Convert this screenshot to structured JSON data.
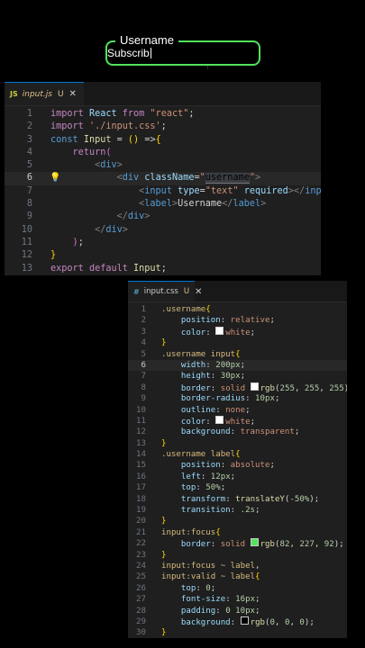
{
  "demo": {
    "label": "Username",
    "value": "Subscrib",
    "accent": "#52e35c"
  },
  "jsx_editor": {
    "tab": {
      "icon_text": "JS",
      "filename": "input.js",
      "status": "U",
      "close": "✕",
      "icon_color": "#cbcb41"
    },
    "lines": [
      [
        [
          "k",
          "import "
        ],
        [
          "v",
          "React "
        ],
        [
          "k",
          "from "
        ],
        [
          "s",
          "\"react\""
        ],
        [
          "p",
          ";"
        ]
      ],
      [
        [
          "k",
          "import "
        ],
        [
          "s",
          "'./input.css'"
        ],
        [
          "p",
          ";"
        ]
      ],
      [
        [
          "kb",
          "const "
        ],
        [
          "f",
          "Input "
        ],
        [
          "p",
          "= "
        ],
        [
          "br1",
          "()"
        ],
        [
          "p",
          " =>"
        ],
        [
          "br1",
          "{"
        ]
      ],
      [
        [
          "p",
          "    "
        ],
        [
          "k",
          "return"
        ],
        [
          "br2",
          "("
        ]
      ],
      [
        [
          "p",
          "        "
        ],
        [
          "tg",
          "<"
        ],
        [
          "kb",
          "div"
        ],
        [
          "tg",
          ">"
        ]
      ],
      [
        [
          "p",
          "            "
        ],
        [
          "tg",
          "<"
        ],
        [
          "kb",
          "div "
        ],
        [
          "at",
          "className"
        ],
        [
          "p",
          "="
        ],
        [
          "s",
          "\""
        ],
        [
          "hl",
          "username"
        ],
        [
          "s",
          "\""
        ],
        [
          "tg",
          ">"
        ]
      ],
      [
        [
          "p",
          "                "
        ],
        [
          "tg",
          "<"
        ],
        [
          "kb",
          "input "
        ],
        [
          "at",
          "type"
        ],
        [
          "p",
          "="
        ],
        [
          "s",
          "\"text\" "
        ],
        [
          "at",
          "required"
        ],
        [
          "tg",
          "></"
        ],
        [
          "kb",
          "input"
        ],
        [
          "tg",
          ">"
        ]
      ],
      [
        [
          "p",
          "                "
        ],
        [
          "tg",
          "<"
        ],
        [
          "kb",
          "label"
        ],
        [
          "tg",
          ">"
        ],
        [
          "tx",
          "Username"
        ],
        [
          "tg",
          "</"
        ],
        [
          "kb",
          "label"
        ],
        [
          "tg",
          ">"
        ]
      ],
      [
        [
          "p",
          "            "
        ],
        [
          "tg",
          "</"
        ],
        [
          "kb",
          "div"
        ],
        [
          "tg",
          ">"
        ]
      ],
      [
        [
          "p",
          "        "
        ],
        [
          "tg",
          "</"
        ],
        [
          "kb",
          "div"
        ],
        [
          "tg",
          ">"
        ]
      ],
      [
        [
          "p",
          "    "
        ],
        [
          "br2",
          ")"
        ],
        [
          "p",
          ";"
        ]
      ],
      [
        [
          "br1",
          "}"
        ]
      ],
      [
        [
          "k",
          "export "
        ],
        [
          "k",
          "default "
        ],
        [
          "f",
          "Input"
        ],
        [
          "p",
          ";"
        ]
      ]
    ]
  },
  "css_editor": {
    "tab": {
      "icon_text": "#",
      "filename": "input.css",
      "status": "U",
      "close": "✕",
      "icon_color": "#519aba"
    },
    "lines": [
      [
        [
          "sel",
          ".username"
        ],
        [
          "br1",
          "{"
        ]
      ],
      [
        [
          "p",
          "    "
        ],
        [
          "prop",
          "position"
        ],
        [
          "p",
          ": "
        ],
        [
          "val",
          "relative"
        ],
        [
          "p",
          ";"
        ]
      ],
      [
        [
          "p",
          "    "
        ],
        [
          "prop",
          "color"
        ],
        [
          "p",
          ": "
        ],
        [
          "sw",
          "#ffffff"
        ],
        [
          "val",
          "white"
        ],
        [
          "p",
          ";"
        ]
      ],
      [
        [
          "br1",
          "}"
        ]
      ],
      [
        [
          "sel",
          ".username input"
        ],
        [
          "br1",
          "{"
        ]
      ],
      [
        [
          "p",
          "    "
        ],
        [
          "prop",
          "width"
        ],
        [
          "p",
          ": "
        ],
        [
          "num",
          "200px"
        ],
        [
          "p",
          ";"
        ]
      ],
      [
        [
          "p",
          "    "
        ],
        [
          "prop",
          "height"
        ],
        [
          "p",
          ": "
        ],
        [
          "num",
          "30px"
        ],
        [
          "p",
          ";"
        ]
      ],
      [
        [
          "p",
          "    "
        ],
        [
          "prop",
          "border"
        ],
        [
          "p",
          ": "
        ],
        [
          "val",
          "solid "
        ],
        [
          "sw",
          "#ffffff"
        ],
        [
          "f",
          "rgb"
        ],
        [
          "p",
          "("
        ],
        [
          "num",
          "255"
        ],
        [
          "p",
          ", "
        ],
        [
          "num",
          "255"
        ],
        [
          "p",
          ", "
        ],
        [
          "num",
          "255"
        ],
        [
          "p",
          ");"
        ]
      ],
      [
        [
          "p",
          "    "
        ],
        [
          "prop",
          "border-radius"
        ],
        [
          "p",
          ": "
        ],
        [
          "num",
          "10px"
        ],
        [
          "p",
          ";"
        ]
      ],
      [
        [
          "p",
          "    "
        ],
        [
          "prop",
          "outline"
        ],
        [
          "p",
          ": "
        ],
        [
          "val",
          "none"
        ],
        [
          "p",
          ";"
        ]
      ],
      [
        [
          "p",
          "    "
        ],
        [
          "prop",
          "color"
        ],
        [
          "p",
          ": "
        ],
        [
          "sw",
          "#ffffff"
        ],
        [
          "val",
          "white"
        ],
        [
          "p",
          ";"
        ]
      ],
      [
        [
          "p",
          "    "
        ],
        [
          "prop",
          "background"
        ],
        [
          "p",
          ": "
        ],
        [
          "val",
          "transparent"
        ],
        [
          "p",
          ";"
        ]
      ],
      [
        [
          "br1",
          "}"
        ]
      ],
      [
        [
          "sel",
          ".username label"
        ],
        [
          "br1",
          "{"
        ]
      ],
      [
        [
          "p",
          "    "
        ],
        [
          "prop",
          "position"
        ],
        [
          "p",
          ": "
        ],
        [
          "val",
          "absolute"
        ],
        [
          "p",
          ";"
        ]
      ],
      [
        [
          "p",
          "    "
        ],
        [
          "prop",
          "left"
        ],
        [
          "p",
          ": "
        ],
        [
          "num",
          "12px"
        ],
        [
          "p",
          ";"
        ]
      ],
      [
        [
          "p",
          "    "
        ],
        [
          "prop",
          "top"
        ],
        [
          "p",
          ": "
        ],
        [
          "num",
          "50%"
        ],
        [
          "p",
          ";"
        ]
      ],
      [
        [
          "p",
          "    "
        ],
        [
          "prop",
          "transform"
        ],
        [
          "p",
          ": "
        ],
        [
          "f",
          "translateY"
        ],
        [
          "p",
          "("
        ],
        [
          "num",
          "-50%"
        ],
        [
          "p",
          ");"
        ]
      ],
      [
        [
          "p",
          "    "
        ],
        [
          "prop",
          "transition"
        ],
        [
          "p",
          ": "
        ],
        [
          "num",
          ".2s"
        ],
        [
          "p",
          ";"
        ]
      ],
      [
        [
          "br1",
          "}"
        ]
      ],
      [
        [
          "sel",
          "input:focus"
        ],
        [
          "br1",
          "{"
        ]
      ],
      [
        [
          "p",
          "    "
        ],
        [
          "prop",
          "border"
        ],
        [
          "p",
          ": "
        ],
        [
          "val",
          "solid "
        ],
        [
          "sw",
          "#52e35c"
        ],
        [
          "f",
          "rgb"
        ],
        [
          "p",
          "("
        ],
        [
          "num",
          "82"
        ],
        [
          "p",
          ", "
        ],
        [
          "num",
          "227"
        ],
        [
          "p",
          ", "
        ],
        [
          "num",
          "92"
        ],
        [
          "p",
          ");"
        ]
      ],
      [
        [
          "br1",
          "}"
        ]
      ],
      [
        [
          "sel",
          "input:focus ~ label"
        ],
        [
          "p",
          ","
        ]
      ],
      [
        [
          "sel",
          "input:valid ~ label"
        ],
        [
          "br1",
          "{"
        ]
      ],
      [
        [
          "p",
          "    "
        ],
        [
          "prop",
          "top"
        ],
        [
          "p",
          ": "
        ],
        [
          "num",
          "0"
        ],
        [
          "p",
          ";"
        ]
      ],
      [
        [
          "p",
          "    "
        ],
        [
          "prop",
          "font-size"
        ],
        [
          "p",
          ": "
        ],
        [
          "num",
          "16px"
        ],
        [
          "p",
          ";"
        ]
      ],
      [
        [
          "p",
          "    "
        ],
        [
          "prop",
          "padding"
        ],
        [
          "p",
          ": "
        ],
        [
          "num",
          "0 10px"
        ],
        [
          "p",
          ";"
        ]
      ],
      [
        [
          "p",
          "    "
        ],
        [
          "prop",
          "background"
        ],
        [
          "p",
          ": "
        ],
        [
          "sw",
          "#000000"
        ],
        [
          "f",
          "rgb"
        ],
        [
          "p",
          "("
        ],
        [
          "num",
          "0"
        ],
        [
          "p",
          ", "
        ],
        [
          "num",
          "0"
        ],
        [
          "p",
          ", "
        ],
        [
          "num",
          "0"
        ],
        [
          "p",
          ");"
        ]
      ],
      [
        [
          "br1",
          "}"
        ]
      ]
    ]
  }
}
